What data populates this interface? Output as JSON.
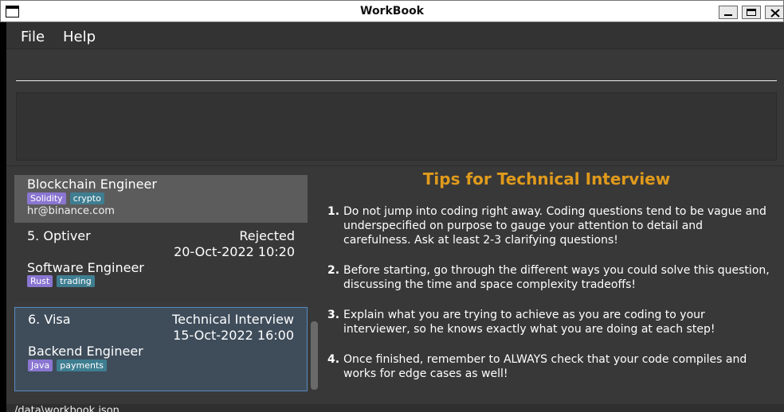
{
  "window": {
    "title": "WorkBook"
  },
  "menu": {
    "file": "File",
    "help": "Help"
  },
  "command": {
    "value": "",
    "placeholder": ""
  },
  "result": {
    "text": ""
  },
  "applications": [
    {
      "role": "Blockchain Engineer",
      "tags": [
        "Solidity",
        "crypto"
      ],
      "email": "hr@binance.com"
    },
    {
      "index": "5.",
      "company": "Optiver",
      "title": "5.  Optiver",
      "status": "Rejected",
      "date": "20-Oct-2022 10:20",
      "role": "Software Engineer",
      "tags": [
        "Rust",
        "trading"
      ]
    },
    {
      "index": "6.",
      "company": "Visa",
      "title": "6.  Visa",
      "status": "Technical Interview",
      "date": "15-Oct-2022 16:00",
      "role": "Backend Engineer",
      "tags": [
        "Java",
        "payments"
      ]
    }
  ],
  "tips": {
    "title": "Tips for Technical Interview",
    "items": [
      {
        "num": "1.",
        "text": "Do not jump into coding right away. Coding questions tend to be vague and underspecified on purpose to gauge your attention to detail and carefulness. Ask at least 2-3 clarifying questions!"
      },
      {
        "num": "2.",
        "text": "Before starting, go through the different ways you could solve this question, discussing the time and space complexity tradeoffs!"
      },
      {
        "num": "3.",
        "text": "Explain what you are trying to achieve as you are coding to your interviewer, so he knows exactly what you are doing at each step!"
      },
      {
        "num": "4.",
        "text": "Once finished, remember to ALWAYS check that your code compiles and works for edge cases as well!"
      }
    ]
  },
  "status": {
    "path": "/data\\workbook.json"
  },
  "colors": {
    "tips_title": "#e09a1c",
    "language_tag": "#8a76d1",
    "category_tag": "#3f7e91",
    "selected_border": "#5a8ac0"
  }
}
